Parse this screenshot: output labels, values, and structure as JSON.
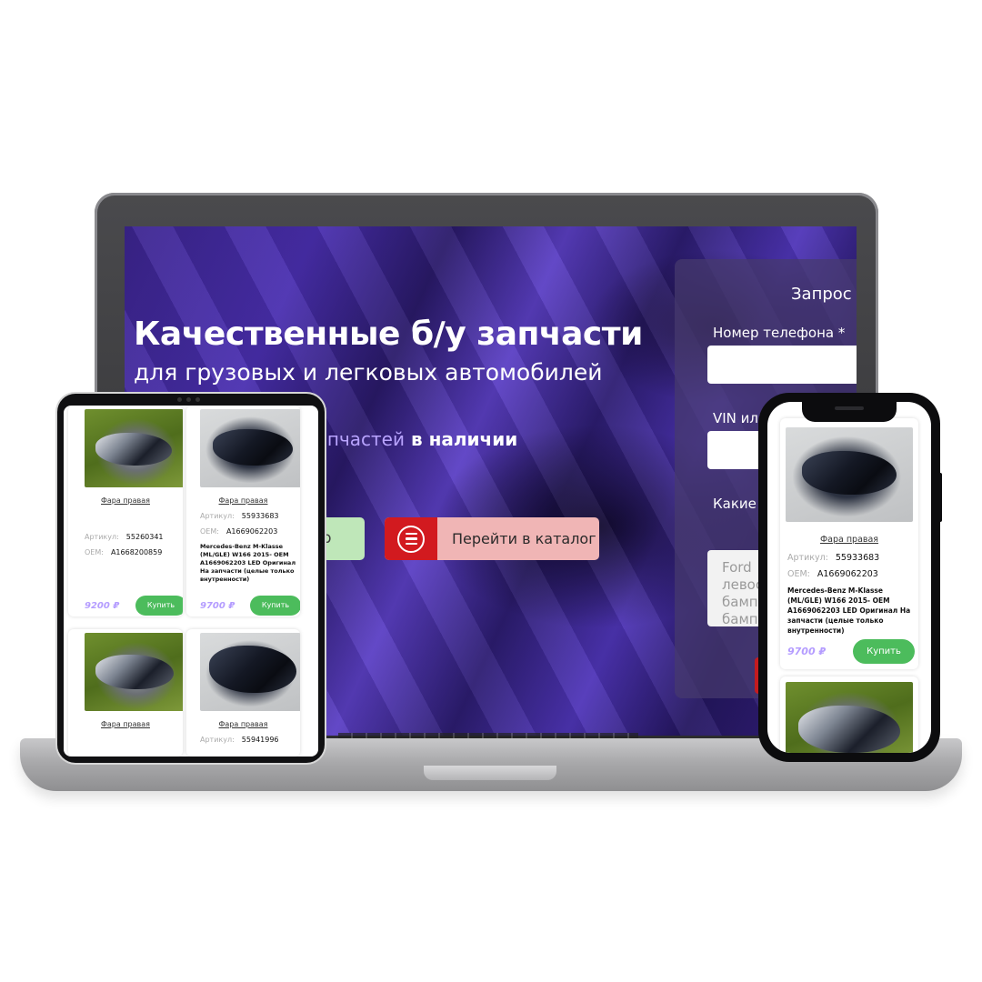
{
  "hero": {
    "title": "Качественные б/у запчасти",
    "subtitle": "для грузовых и легковых автомобилей",
    "stock_accent": "запчастей",
    "stock_rest": " в наличии",
    "app_button_fragment": "pp",
    "catalog_button": "Перейти в каталог",
    "catalog_icon": "menu-circle-icon"
  },
  "form": {
    "title": "Запрос",
    "phone_label": "Номер телефона *",
    "vin_label": "VIN или",
    "parts_label": "Какие",
    "textarea_text": "Ford\nлевос\nбамп\nбамп"
  },
  "tablet": {
    "cards": [
      {
        "name": "Фара правая",
        "sku_label": "Артикул:",
        "sku": "55260341",
        "oem_label": "OEM:",
        "oem": "A1668200859",
        "description": "",
        "price": "9200 ₽",
        "buy": "Купить"
      },
      {
        "name": "Фара правая",
        "sku_label": "Артикул:",
        "sku": "55933683",
        "oem_label": "OEM:",
        "oem": "A1669062203",
        "description": "Mercedes-Benz M-Klasse (ML/GLE) W166 2015- OEM A1669062203 LED Оригинал На запчасти (целые только внутренности)",
        "price": "9700 ₽",
        "buy": "Купить"
      },
      {
        "name": "Фара правая"
      },
      {
        "name": "Фара правая",
        "sku_label": "Артикул:",
        "sku": "55941996"
      }
    ]
  },
  "phone": {
    "card": {
      "name": "Фара правая",
      "sku_label": "Артикул:",
      "sku": "55933683",
      "oem_label": "OEM:",
      "oem": "A1669062203",
      "description": "Mercedes-Benz M-Klasse (ML/GLE) W166 2015- OEM A1669062203 LED Оригинал На запчасти (целые только внутренности)",
      "price": "9700 ₽",
      "buy": "Купить"
    }
  },
  "colors": {
    "accent": "#b49cff",
    "buy": "#4cbc5c",
    "catalog_red": "#d21a1f"
  }
}
